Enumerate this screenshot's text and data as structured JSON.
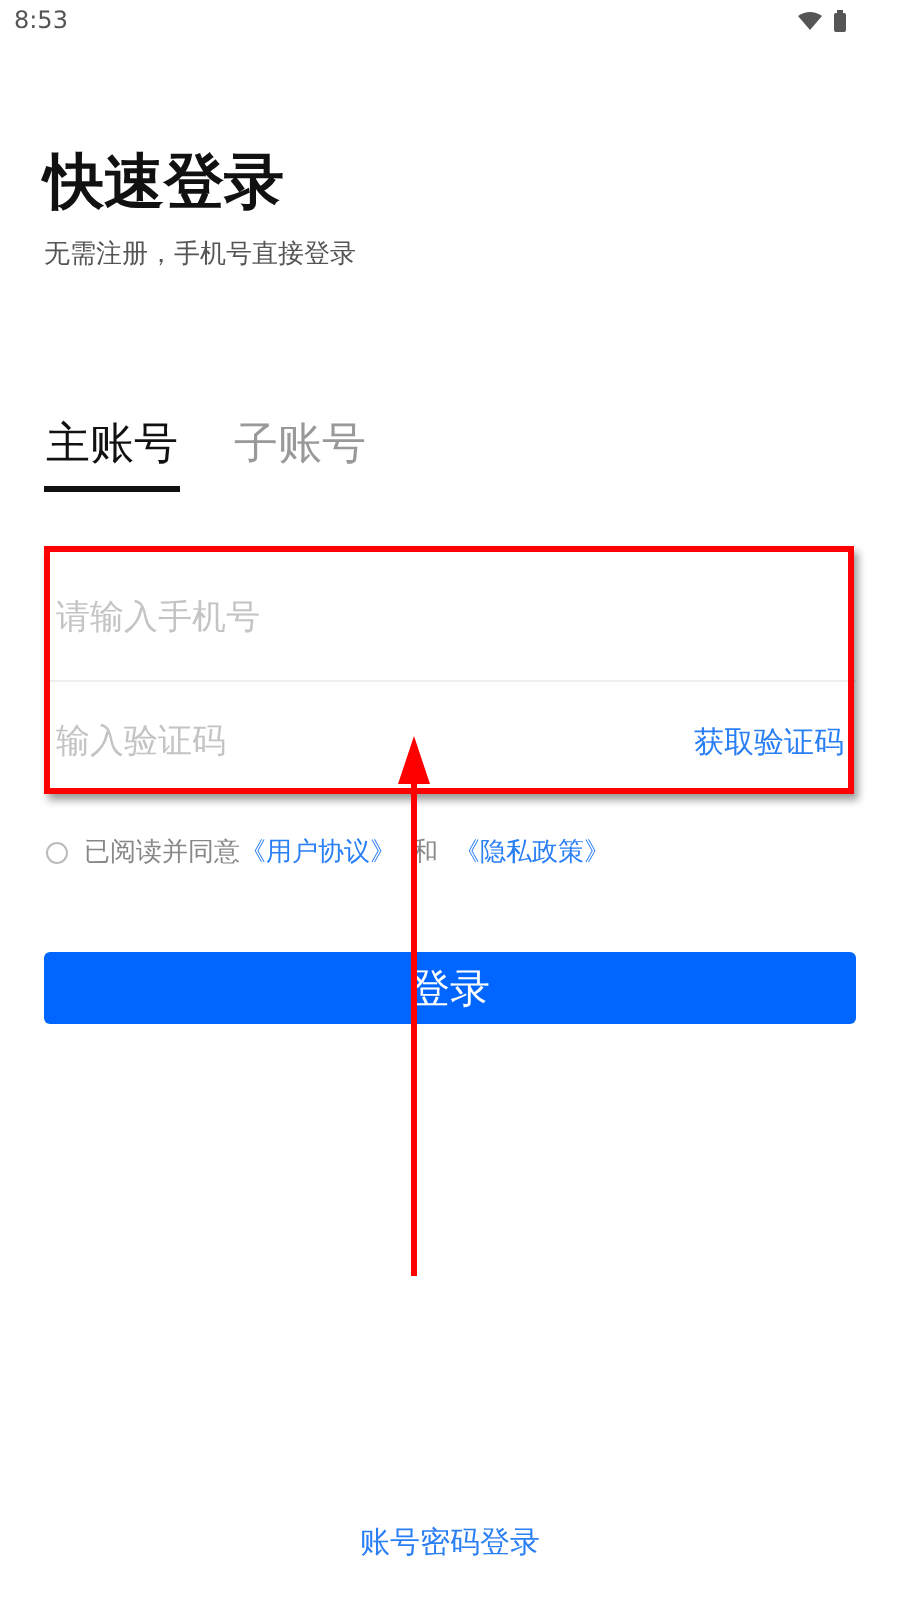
{
  "status_bar": {
    "time": "8:53"
  },
  "title": "快速登录",
  "subtitle": "无需注册，手机号直接登录",
  "tabs": [
    {
      "label": "主账号",
      "selected": true
    },
    {
      "label": "子账号",
      "selected": false
    }
  ],
  "phone_field": {
    "placeholder": "请输入手机号"
  },
  "code_field": {
    "placeholder": "输入验证码"
  },
  "get_code_button": "获取验证码",
  "agreement": {
    "checked": false,
    "text": "已阅读并同意",
    "user_agreement_link": "《用户协议》",
    "conjunction": "和",
    "privacy_policy_link": "《隐私政策》"
  },
  "login_button": "登录",
  "password_login_link": "账号密码登录"
}
